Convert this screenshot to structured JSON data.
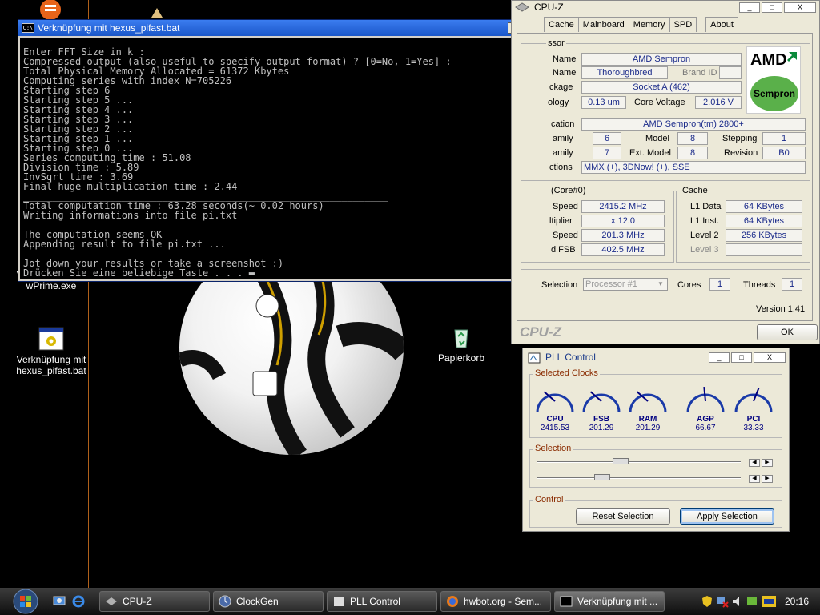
{
  "desktop": {
    "icons": [
      {
        "label": "Verknüpfung mit wPrime.exe"
      },
      {
        "label": "Verknüpfung mit hexus_pifast.bat"
      },
      {
        "label": "Papierkorb"
      }
    ]
  },
  "console": {
    "title": "Verknüpfung mit hexus_pifast.bat",
    "cmd_icon": "C:\\",
    "buttons": {
      "minimize": "_",
      "maximize": "□",
      "close": "X"
    },
    "lines": [
      "Enter FFT Size in k :",
      "Compressed output (also useful to specify output format) ? [0=No, 1=Yes] :",
      "Total Physical Memory Allocated = 61372 Kbytes",
      "Computing series with index N=705226",
      "Starting step 6",
      "Starting step 5 ...",
      "Starting step 4 ...",
      "Starting step 3 ...",
      "Starting step 2 ...",
      "Starting step 1 ...",
      "Starting step 0 ...",
      "Series computing time : 51.08",
      "Division time : 5.89",
      "InvSqrt time : 3.69",
      "Final huge multiplication time : 2.44",
      "_______________________________________________________________",
      "Total computation time : 63.28 seconds(~ 0.02 hours)",
      "Writing informations into file pi.txt",
      "",
      "The computation seems OK",
      "Appending result to file pi.txt ...",
      "",
      "Jot down your results or take a screenshot :)",
      "Drücken Sie eine beliebige Taste . . . ▬"
    ]
  },
  "cpuz": {
    "title": "CPU-Z",
    "window_buttons": {
      "minimize": "_",
      "maximize": "□",
      "close": "X"
    },
    "tabs": [
      "Cache",
      "Mainboard",
      "Memory",
      "SPD",
      "About"
    ],
    "processor_group": "ssor",
    "labels": {
      "name": "Name",
      "codename": "Name",
      "brand_id": "Brand ID",
      "package": "ckage",
      "technology": "ology",
      "core_voltage": "Core Voltage",
      "specification": "cation",
      "family": "amily",
      "model": "Model",
      "stepping": "Stepping",
      "ext_family": "amily",
      "ext_model": "Ext. Model",
      "revision": "Revision",
      "instructions": "ctions",
      "clocks_group": "(Core#0)",
      "core_speed": "Speed",
      "multiplier": "ltiplier",
      "bus_speed": "Speed",
      "rated_fsb": "d FSB",
      "cache_group": "Cache",
      "l1_data": "L1 Data",
      "l1_inst": "L1 Inst.",
      "level2": "Level 2",
      "level3": "Level 3",
      "selection": "Selection",
      "cores": "Cores",
      "threads": "Threads"
    },
    "values": {
      "name": "AMD Sempron",
      "codename": "Thoroughbred",
      "package": "Socket A (462)",
      "technology": "0.13 um",
      "core_voltage": "2.016 V",
      "specification": "AMD Sempron(tm)   2800+",
      "family": "6",
      "model": "8",
      "stepping": "1",
      "ext_family": "7",
      "ext_model": "8",
      "revision": "B0",
      "instructions": "MMX (+), 3DNow! (+), SSE",
      "core_speed": "2415.2 MHz",
      "multiplier": "x 12.0",
      "bus_speed": "201.3 MHz",
      "rated_fsb": "402.5 MHz",
      "l1_data": "64 KBytes",
      "l1_inst": "64 KBytes",
      "level2": "256 KBytes",
      "level3": "",
      "selection": "Processor #1",
      "cores": "1",
      "threads": "1"
    },
    "logo": {
      "brand": "AMD",
      "product": "Sempron"
    },
    "version": "Version 1.41",
    "footer_brand": "CPU-Z",
    "ok_label": "OK"
  },
  "pll": {
    "title": "PLL Control",
    "window_buttons": {
      "minimize": "_",
      "maximize": "□",
      "close": "X"
    },
    "selected_clocks_label": "Selected Clocks",
    "gauges": [
      {
        "label": "CPU",
        "value": "2415.53",
        "fraction": 0.32
      },
      {
        "label": "FSB",
        "value": "201.29",
        "fraction": 0.32
      },
      {
        "label": "RAM",
        "value": "201.29",
        "fraction": 0.32
      },
      {
        "label": "AGP",
        "value": "66.67",
        "fraction": 0.48
      },
      {
        "label": "PCI",
        "value": "33.33",
        "fraction": 0.58
      }
    ],
    "selection_label": "Selection",
    "sliders": [
      {
        "fraction": 0.41
      },
      {
        "fraction": 0.32
      }
    ],
    "control_label": "Control",
    "reset_label": "Reset Selection",
    "apply_label": "Apply Selection"
  },
  "taskbar": {
    "tasks": [
      {
        "label": "CPU-Z"
      },
      {
        "label": "ClockGen"
      },
      {
        "label": "PLL Control"
      },
      {
        "label": "hwbot.org - Sem..."
      },
      {
        "label": "Verknüpfung mit ..."
      }
    ],
    "clock": "20:16"
  },
  "colors": {
    "accent": "#3b7df0",
    "value_text": "#1a2a8a",
    "gauge_blue": "#000080",
    "section_title": "#8a2b00"
  }
}
